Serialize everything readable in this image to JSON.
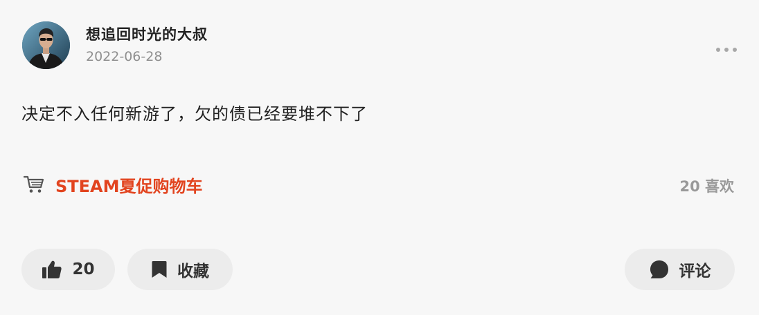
{
  "post": {
    "author": {
      "name": "想追回时光的大叔",
      "date": "2022-06-28"
    },
    "content": "决定不入任何新游了，欠的债已经要堆不下了",
    "topic": {
      "label": "STEAM夏促购物车",
      "likes_text": "20 喜欢",
      "accent_color": "#e2441f"
    },
    "actions": {
      "like_count": "20",
      "collect_label": "收藏",
      "comment_label": "评论"
    }
  },
  "icons": {
    "more": "more-dots-icon",
    "cart": "shopping-cart-icon",
    "like": "thumbs-up-icon",
    "collect": "bookmark-icon",
    "comment": "comment-bubble-icon"
  }
}
